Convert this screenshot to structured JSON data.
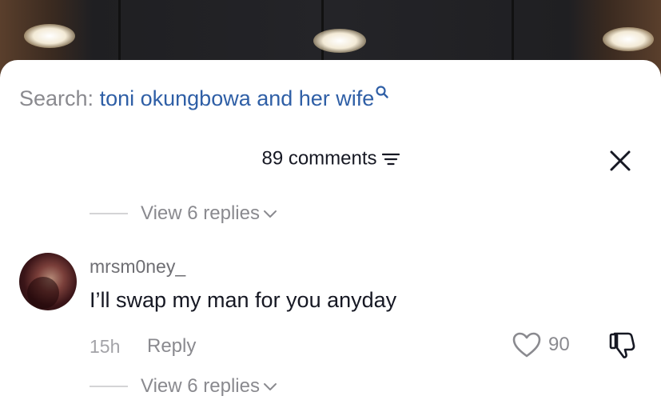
{
  "search": {
    "prefix": "Search:",
    "query": "toni okungbowa and her wife",
    "icon": "search-icon"
  },
  "comments_header": {
    "count_label": "89 comments",
    "filter_icon": "filter-icon",
    "close_icon": "close-icon"
  },
  "thread_above": {
    "view_replies_label": "View 6 replies"
  },
  "comment": {
    "username": "mrsm0ney_",
    "text": "I’ll swap my man for you anyday",
    "time": "15h",
    "reply_label": "Reply",
    "like_count": "90",
    "view_replies_label": "View 6 replies"
  },
  "colors": {
    "link_blue": "#2f5fa6",
    "muted_text": "#8a8a8f",
    "primary_text": "#161823"
  }
}
